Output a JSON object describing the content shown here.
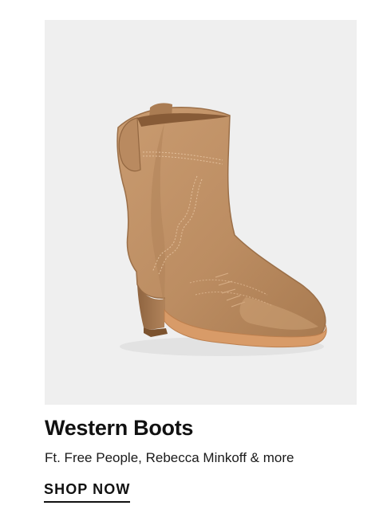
{
  "promo": {
    "image_alt": "Tan leather western ankle boot",
    "image_name": "western-boot-photo",
    "title": "Western Boots",
    "subtitle": "Ft. Free People, Rebecca Minkoff & more",
    "cta_label": "SHOP NOW"
  },
  "colors": {
    "image_background": "#efefef",
    "boot_leather": "#c39468",
    "boot_shadow": "#a6774c",
    "sole": "#d89b68",
    "text": "#111111"
  }
}
